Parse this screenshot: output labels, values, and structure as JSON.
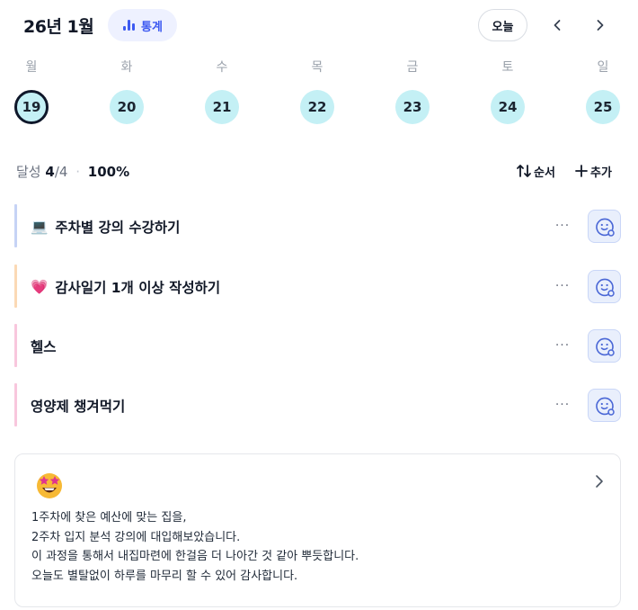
{
  "header": {
    "month_title": "26년 1월",
    "stats_label": "통계",
    "today_label": "오늘",
    "prev_icon": "chevron-left-icon",
    "next_icon": "chevron-right-icon"
  },
  "week": {
    "days": [
      {
        "dow": "월",
        "date": "19",
        "selected": true
      },
      {
        "dow": "화",
        "date": "20",
        "selected": false
      },
      {
        "dow": "수",
        "date": "21",
        "selected": false
      },
      {
        "dow": "목",
        "date": "22",
        "selected": false
      },
      {
        "dow": "금",
        "date": "23",
        "selected": false
      },
      {
        "dow": "토",
        "date": "24",
        "selected": false
      },
      {
        "dow": "일",
        "date": "25",
        "selected": false
      }
    ]
  },
  "summary": {
    "label": "달성",
    "done": "4",
    "total": "/4",
    "separator": "·",
    "percent": "100%",
    "order_label": "순서",
    "add_label": "추가"
  },
  "todos": [
    {
      "emoji": "💻",
      "title": "주차별 강의 수강하기",
      "color": "#c6d3f5"
    },
    {
      "emoji": "💗",
      "title": "감사일기 1개 이상 작성하기",
      "color": "#fbd9b5"
    },
    {
      "emoji": "",
      "title": "헬스",
      "color": "#f8c7dd"
    },
    {
      "emoji": "",
      "title": "영양제 챙겨먹기",
      "color": "#f8c7dd"
    }
  ],
  "todo_more_label": "···",
  "note": {
    "emoji_icon": "star-struck-emoji-icon",
    "lines": [
      "1주차에 찾은 예산에 맞는 집을,",
      "2주차 입지 분석 강의에 대입해보았습니다.",
      "이 과정을 통해서 내집마련에 한걸음 더 나아간 것 같아 뿌듯합니다.",
      "오늘도 별탈없이 하루를 마무리 할 수 있어 감사합니다."
    ]
  },
  "colors": {
    "accent": "#3d5af1",
    "date_circle": "#c4f0f5",
    "react_bg": "#e9effc"
  }
}
